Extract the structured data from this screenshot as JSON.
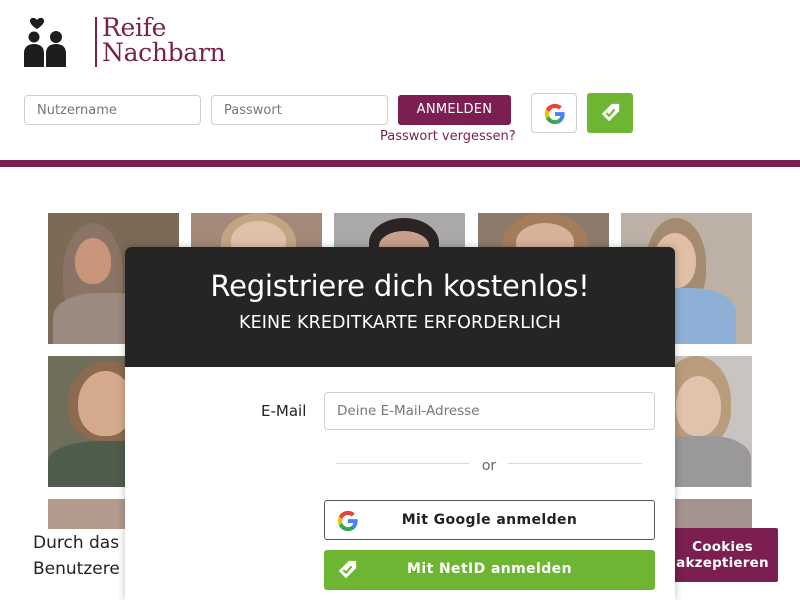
{
  "logo": {
    "line1": "Reife",
    "line2": "Nachbarn"
  },
  "login": {
    "username_placeholder": "Nutzername",
    "password_placeholder": "Passwort",
    "login_label": "ANMELDEN",
    "forgot_label": "Passwort vergessen?"
  },
  "modal": {
    "title": "Registriere dich kostenlos!",
    "subtitle": "KEINE KREDITKARTE ERFORDERLICH",
    "email_label": "E-Mail",
    "email_placeholder": "Deine E-Mail-Adresse",
    "or_label": "or",
    "google_label": "Mit Google anmelden",
    "netid_label": "Mit NetID anmelden"
  },
  "cookie": {
    "text_line1": "Durch das",
    "text_line2": "Benutzere",
    "accept_line1": "Cookies",
    "accept_line2": "akzeptieren"
  },
  "icons": {
    "google": "google-g-icon",
    "netid": "netid-tag-icon",
    "logo": "couple-heart-icon"
  },
  "colors": {
    "brand": "#7a1f4f",
    "netid_green": "#6db533",
    "modal_header": "#252525"
  }
}
